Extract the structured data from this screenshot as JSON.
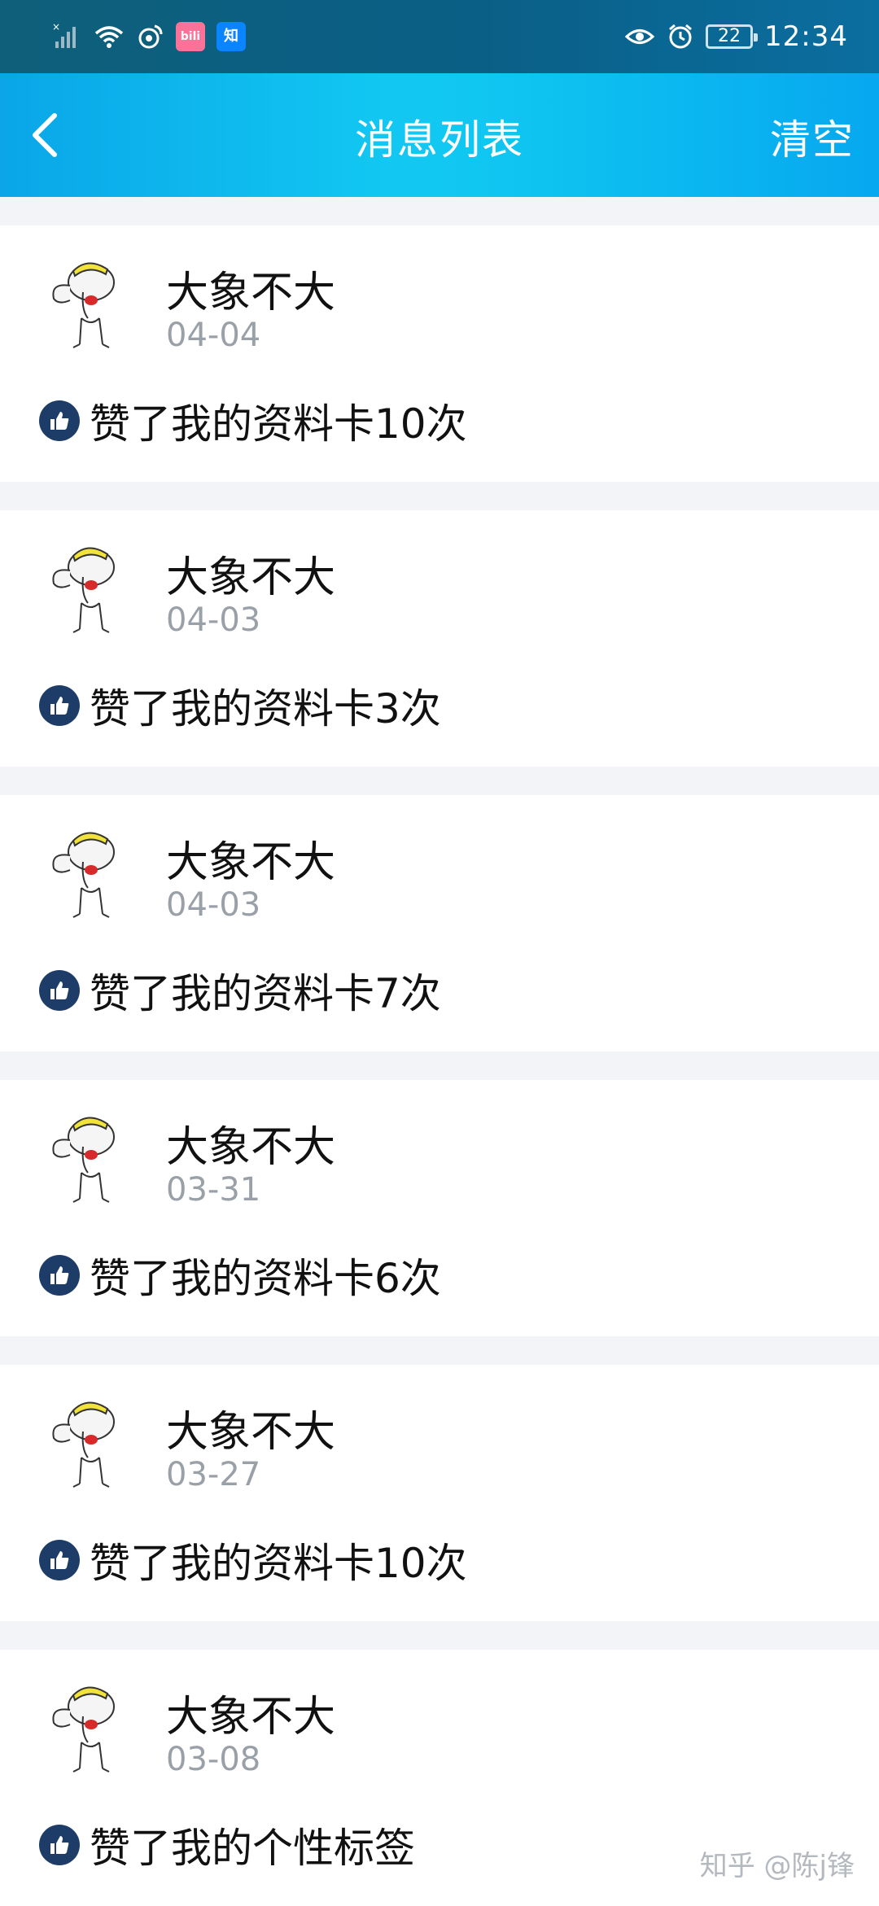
{
  "status_bar": {
    "time": "12:34",
    "battery": "22",
    "app_icons": [
      {
        "name": "weibo",
        "label": "",
        "color": "#ffffff"
      },
      {
        "name": "bilibili",
        "label": "bili",
        "color": "#fb7299"
      },
      {
        "name": "zhihu",
        "label": "知",
        "color": "#0a84ff"
      }
    ]
  },
  "nav": {
    "title": "消息列表",
    "action": "清空",
    "back_icon": "chevron-left-icon"
  },
  "messages": [
    {
      "name": "大象不大",
      "date": "04-04",
      "text": "赞了我的资料卡10次"
    },
    {
      "name": "大象不大",
      "date": "04-03",
      "text": "赞了我的资料卡3次"
    },
    {
      "name": "大象不大",
      "date": "04-03",
      "text": "赞了我的资料卡7次"
    },
    {
      "name": "大象不大",
      "date": "03-31",
      "text": "赞了我的资料卡6次"
    },
    {
      "name": "大象不大",
      "date": "03-27",
      "text": "赞了我的资料卡10次"
    },
    {
      "name": "大象不大",
      "date": "03-08",
      "text": "赞了我的个性标签"
    }
  ],
  "watermark": "知乎 @陈j锋",
  "colors": {
    "accent": "#10c7f1",
    "like_icon": "#1d3c68",
    "date_text": "#9aa0a8"
  }
}
